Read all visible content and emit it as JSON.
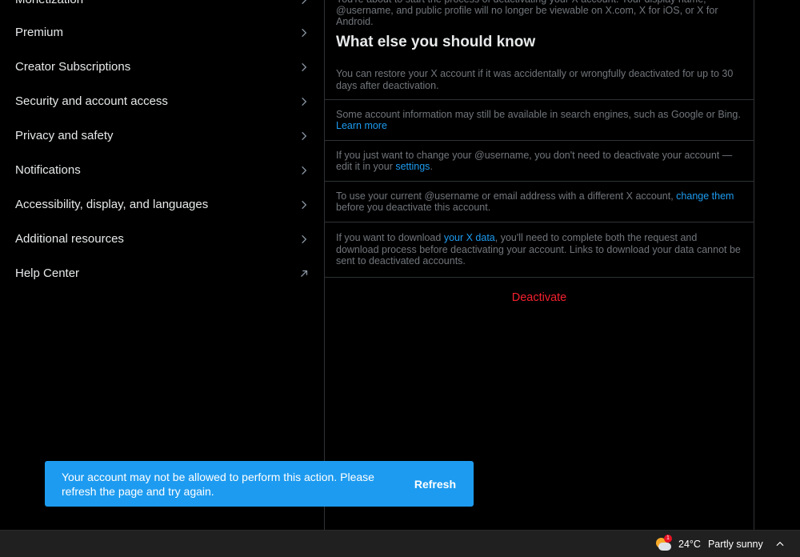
{
  "nav": {
    "items": [
      {
        "label": "Monetization",
        "icon": "chevron-right-icon"
      },
      {
        "label": "Premium",
        "icon": "chevron-right-icon"
      },
      {
        "label": "Creator Subscriptions",
        "icon": "chevron-right-icon"
      },
      {
        "label": "Security and account access",
        "icon": "chevron-right-icon"
      },
      {
        "label": "Privacy and safety",
        "icon": "chevron-right-icon"
      },
      {
        "label": "Notifications",
        "icon": "chevron-right-icon"
      },
      {
        "label": "Accessibility, display, and languages",
        "icon": "chevron-right-icon"
      },
      {
        "label": "Additional resources",
        "icon": "chevron-right-icon"
      },
      {
        "label": "Help Center",
        "icon": "external-link-arrow-icon"
      }
    ]
  },
  "content": {
    "intro": "You're about to start the process of deactivating your X account. Your display name, @username, and public profile will no longer be viewable on X.com, X for iOS, or X for Android.",
    "section_title": "What else you should know",
    "blocks": [
      {
        "text": "You can restore your X account if it was accidentally or wrongfully deactivated for up to 30 days after deactivation."
      },
      {
        "text": "Some account information may still be available in search engines, such as Google or Bing.",
        "link": "Learn more"
      },
      {
        "before": "If you just want to change your @username, you don't need to deactivate your account — edit it in your ",
        "link": "settings",
        "after": "."
      },
      {
        "before": "To use your current @username or email address with a different X account, ",
        "link": "change them",
        "after": " before you deactivate this account."
      },
      {
        "before": "If you want to download ",
        "link": "your X data",
        "after": ", you'll need to complete both the request and download process before deactivating your account. Links to download your data cannot be sent to deactivated accounts."
      }
    ],
    "deactivate_label": "Deactivate"
  },
  "toast": {
    "message": "Your account may not be allowed to perform this action. Please refresh the page and try again.",
    "action_label": "Refresh"
  },
  "taskbar": {
    "weather_badge": "1",
    "temperature": "24°C",
    "condition": "Partly sunny"
  },
  "colors": {
    "accent": "#1d9bf0",
    "danger": "#f4212e",
    "background": "#000000",
    "muted_text": "#71767b",
    "divider": "#2f3336"
  }
}
